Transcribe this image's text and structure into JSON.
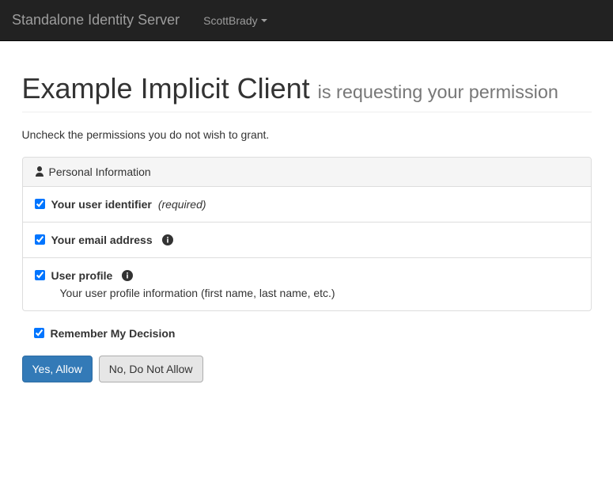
{
  "navbar": {
    "brand": "Standalone Identity Server",
    "user": "ScottBrady"
  },
  "header": {
    "client_name": "Example Implicit Client",
    "suffix": "is requesting your permission"
  },
  "instruction": "Uncheck the permissions you do not wish to grant.",
  "panel": {
    "title": "Personal Information"
  },
  "scopes": [
    {
      "label": "Your user identifier",
      "required_text": "(required)",
      "checked": true,
      "info": false,
      "description": ""
    },
    {
      "label": "Your email address",
      "required_text": "",
      "checked": true,
      "info": true,
      "description": ""
    },
    {
      "label": "User profile",
      "required_text": "",
      "checked": true,
      "info": true,
      "description": "Your user profile information (first name, last name, etc.)"
    }
  ],
  "remember": {
    "label": "Remember My Decision",
    "checked": true
  },
  "buttons": {
    "allow": "Yes, Allow",
    "deny": "No, Do Not Allow"
  }
}
